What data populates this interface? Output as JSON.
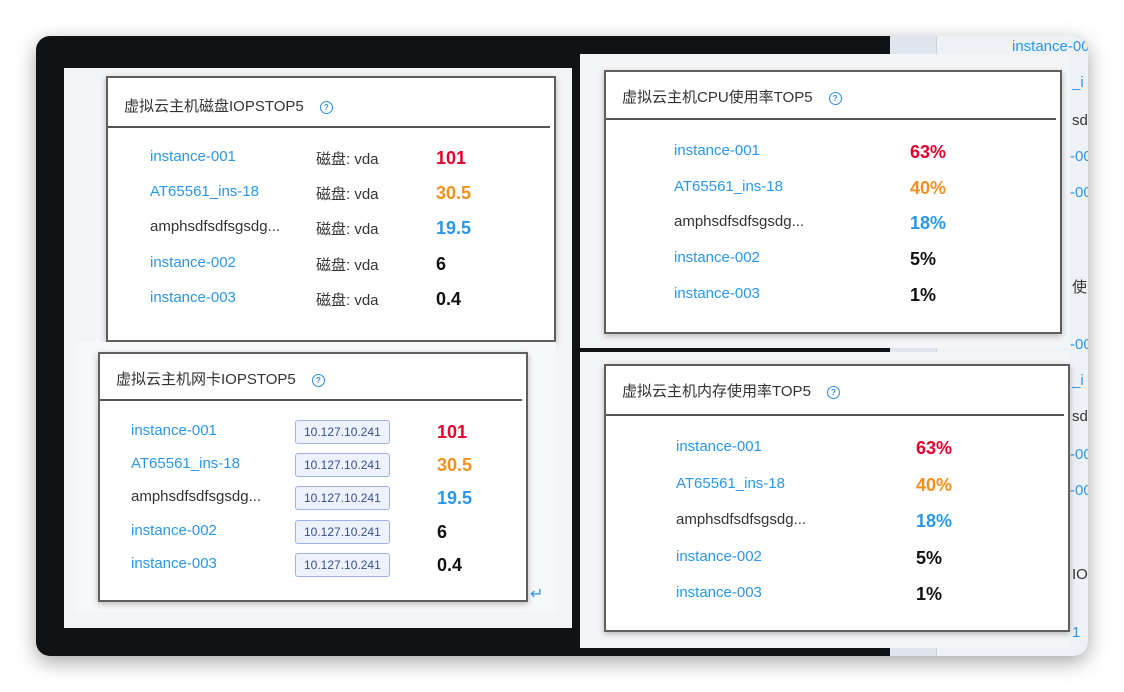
{
  "colors": {
    "red": "#e4002b",
    "orange": "#f5901e",
    "blue": "#2b97ea",
    "black": "#111111"
  },
  "panels": {
    "disk_iops": {
      "title": "虚拟云主机磁盘IOPSTOP5",
      "rows": [
        {
          "name": "instance-001",
          "disk": "磁盘: vda",
          "value": "101"
        },
        {
          "name": "AT65561_ins-18",
          "disk": "磁盘: vda",
          "value": "30.5"
        },
        {
          "name": "amphsdfsdfsgsdg...",
          "disk": "磁盘: vda",
          "value": "19.5"
        },
        {
          "name": "instance-002",
          "disk": "磁盘: vda",
          "value": "6"
        },
        {
          "name": "instance-003",
          "disk": "磁盘: vda",
          "value": "0.4"
        }
      ]
    },
    "nic_iops": {
      "title": "虚拟云主机网卡IOPSTOP5",
      "rows": [
        {
          "name": "instance-001",
          "ip": "10.127.10.241",
          "value": "101"
        },
        {
          "name": "AT65561_ins-18",
          "ip": "10.127.10.241",
          "value": "30.5"
        },
        {
          "name": "amphsdfsdfsgsdg...",
          "ip": "10.127.10.241",
          "value": "19.5"
        },
        {
          "name": "instance-002",
          "ip": "10.127.10.241",
          "value": "6"
        },
        {
          "name": "instance-003",
          "ip": "10.127.10.241",
          "value": "0.4"
        }
      ]
    },
    "cpu_usage": {
      "title": "虚拟云主机CPU使用率TOP5",
      "rows": [
        {
          "name": "instance-001",
          "value": "63%"
        },
        {
          "name": "AT65561_ins-18",
          "value": "40%"
        },
        {
          "name": "amphsdfsdfsgsdg...",
          "value": "18%"
        },
        {
          "name": "instance-002",
          "value": "5%"
        },
        {
          "name": "instance-003",
          "value": "1%"
        }
      ]
    },
    "mem_usage": {
      "title": "虚拟云主机内存使用率TOP5",
      "rows": [
        {
          "name": "instance-001",
          "value": "63%"
        },
        {
          "name": "AT65561_ins-18",
          "value": "40%"
        },
        {
          "name": "amphsdfsdfsgsdg...",
          "value": "18%"
        },
        {
          "name": "instance-002",
          "value": "5%"
        },
        {
          "name": "instance-003",
          "value": "1%"
        }
      ]
    }
  },
  "background_fragments": {
    "top_link": "instance-00",
    "frag_i": "_i",
    "frag_sd": "sd",
    "frag_00a": "-00",
    "frag_00b": "-00",
    "frag_shi": "使",
    "frag_00c": "-00",
    "frag_i2": "_i",
    "frag_sd2": "sd",
    "frag_00d": "-00",
    "frag_00e": "-00",
    "frag_io": "IO",
    "frag_1": "1"
  }
}
